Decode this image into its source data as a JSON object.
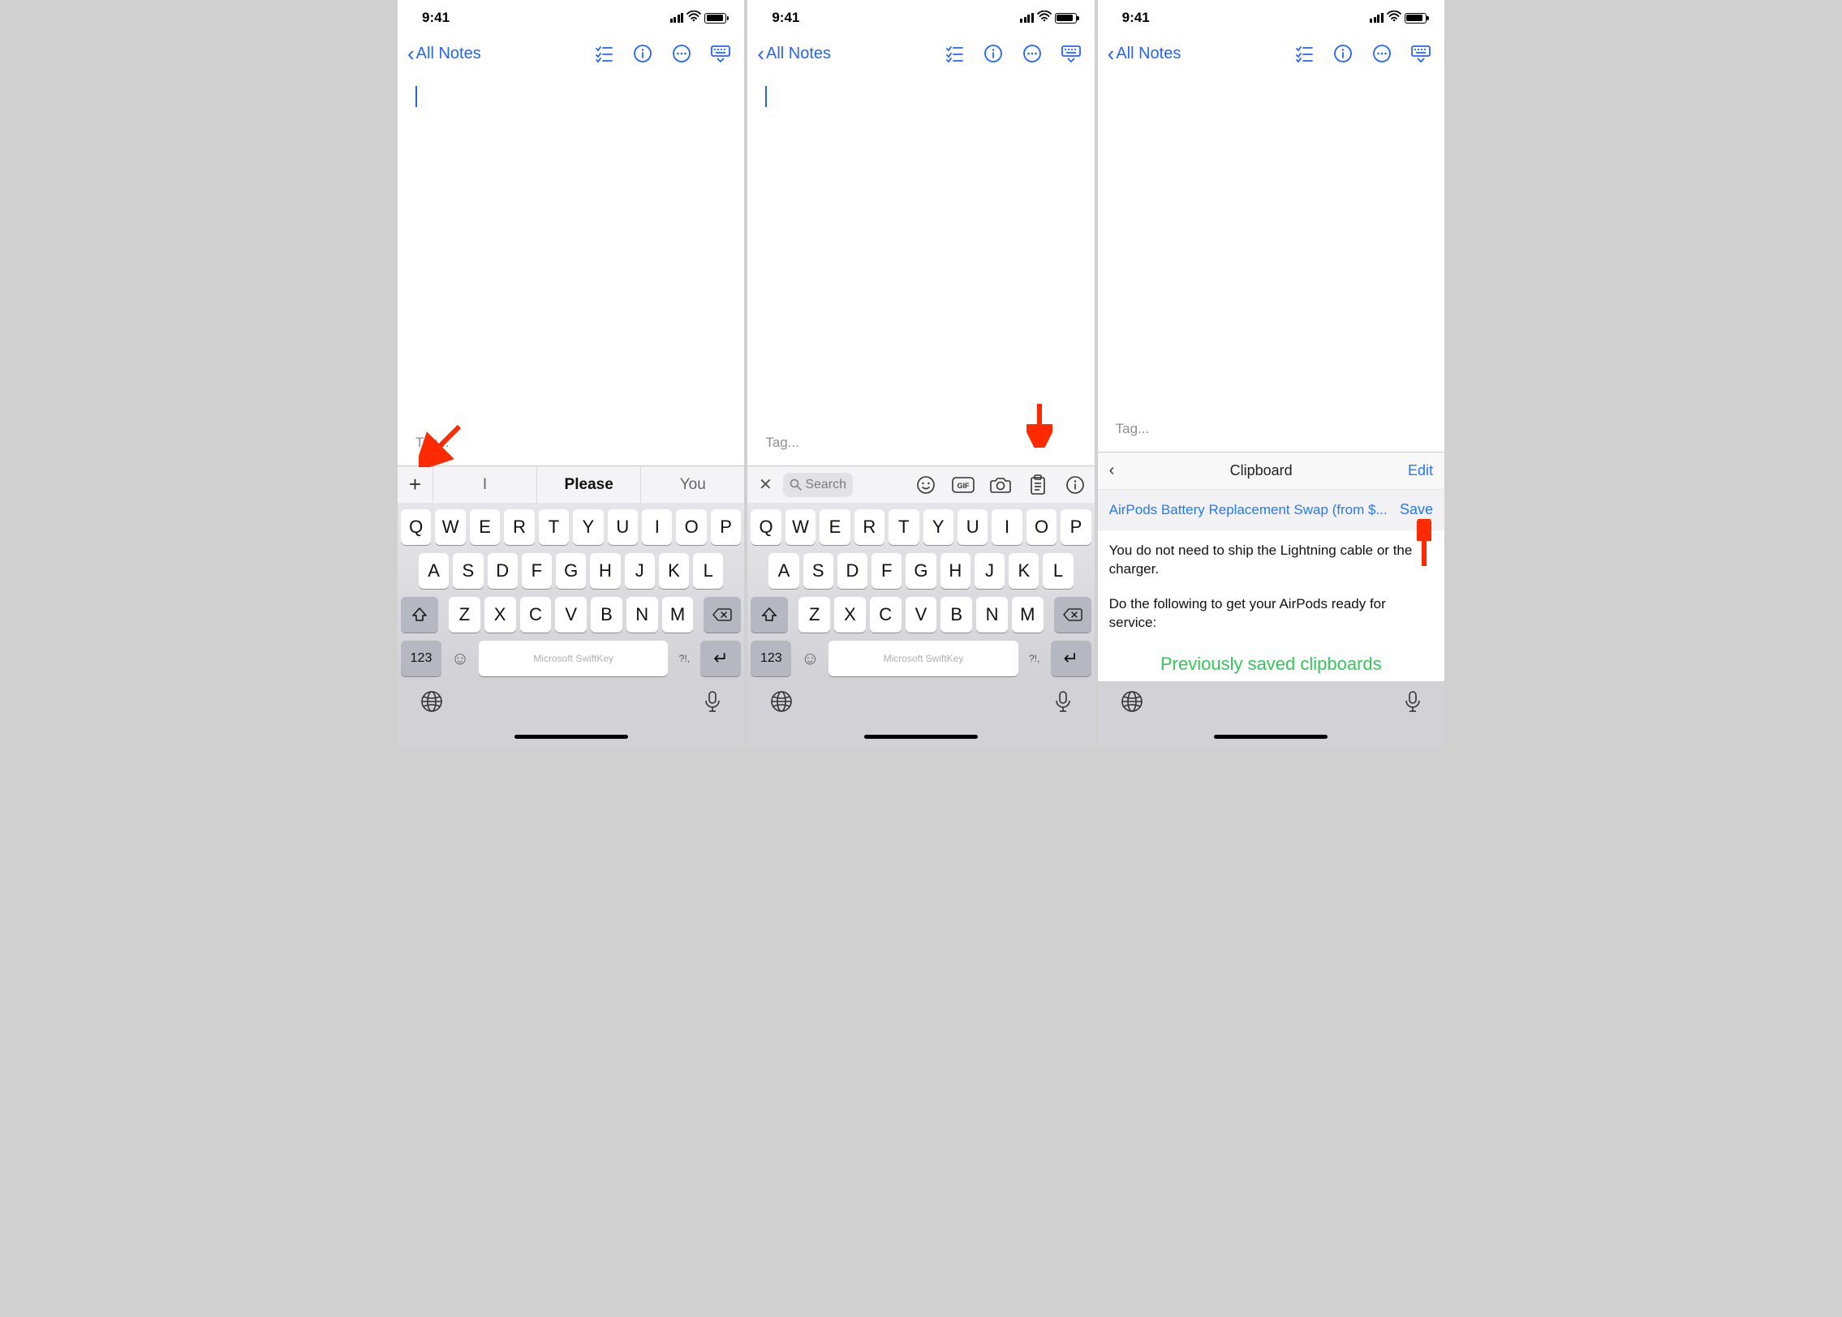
{
  "status": {
    "time": "9:41"
  },
  "nav": {
    "back_label": "All Notes"
  },
  "note": {
    "tag_placeholder": "Tag..."
  },
  "suggest": {
    "s1": "I",
    "s2": "Please",
    "s3": "You"
  },
  "toolbar": {
    "search_placeholder": "Search"
  },
  "keyboard": {
    "row1": [
      "Q",
      "W",
      "E",
      "R",
      "T",
      "Y",
      "U",
      "I",
      "O",
      "P"
    ],
    "row2": [
      "A",
      "S",
      "D",
      "F",
      "G",
      "H",
      "J",
      "K",
      "L"
    ],
    "row3": [
      "Z",
      "X",
      "C",
      "V",
      "B",
      "N",
      "M"
    ],
    "num_label": "123",
    "space_label": "Microsoft SwiftKey",
    "punct_label": "?!,"
  },
  "clipboard": {
    "title": "Clipboard",
    "edit": "Edit",
    "item_title": "AirPods Battery Replacement Swap (from $...",
    "save": "Save",
    "body1": "You do not need to ship the Lightning cable or the charger.",
    "body2": "Do the following to get your AirPods ready for service:",
    "saved_header": "Previously saved clipboards"
  }
}
